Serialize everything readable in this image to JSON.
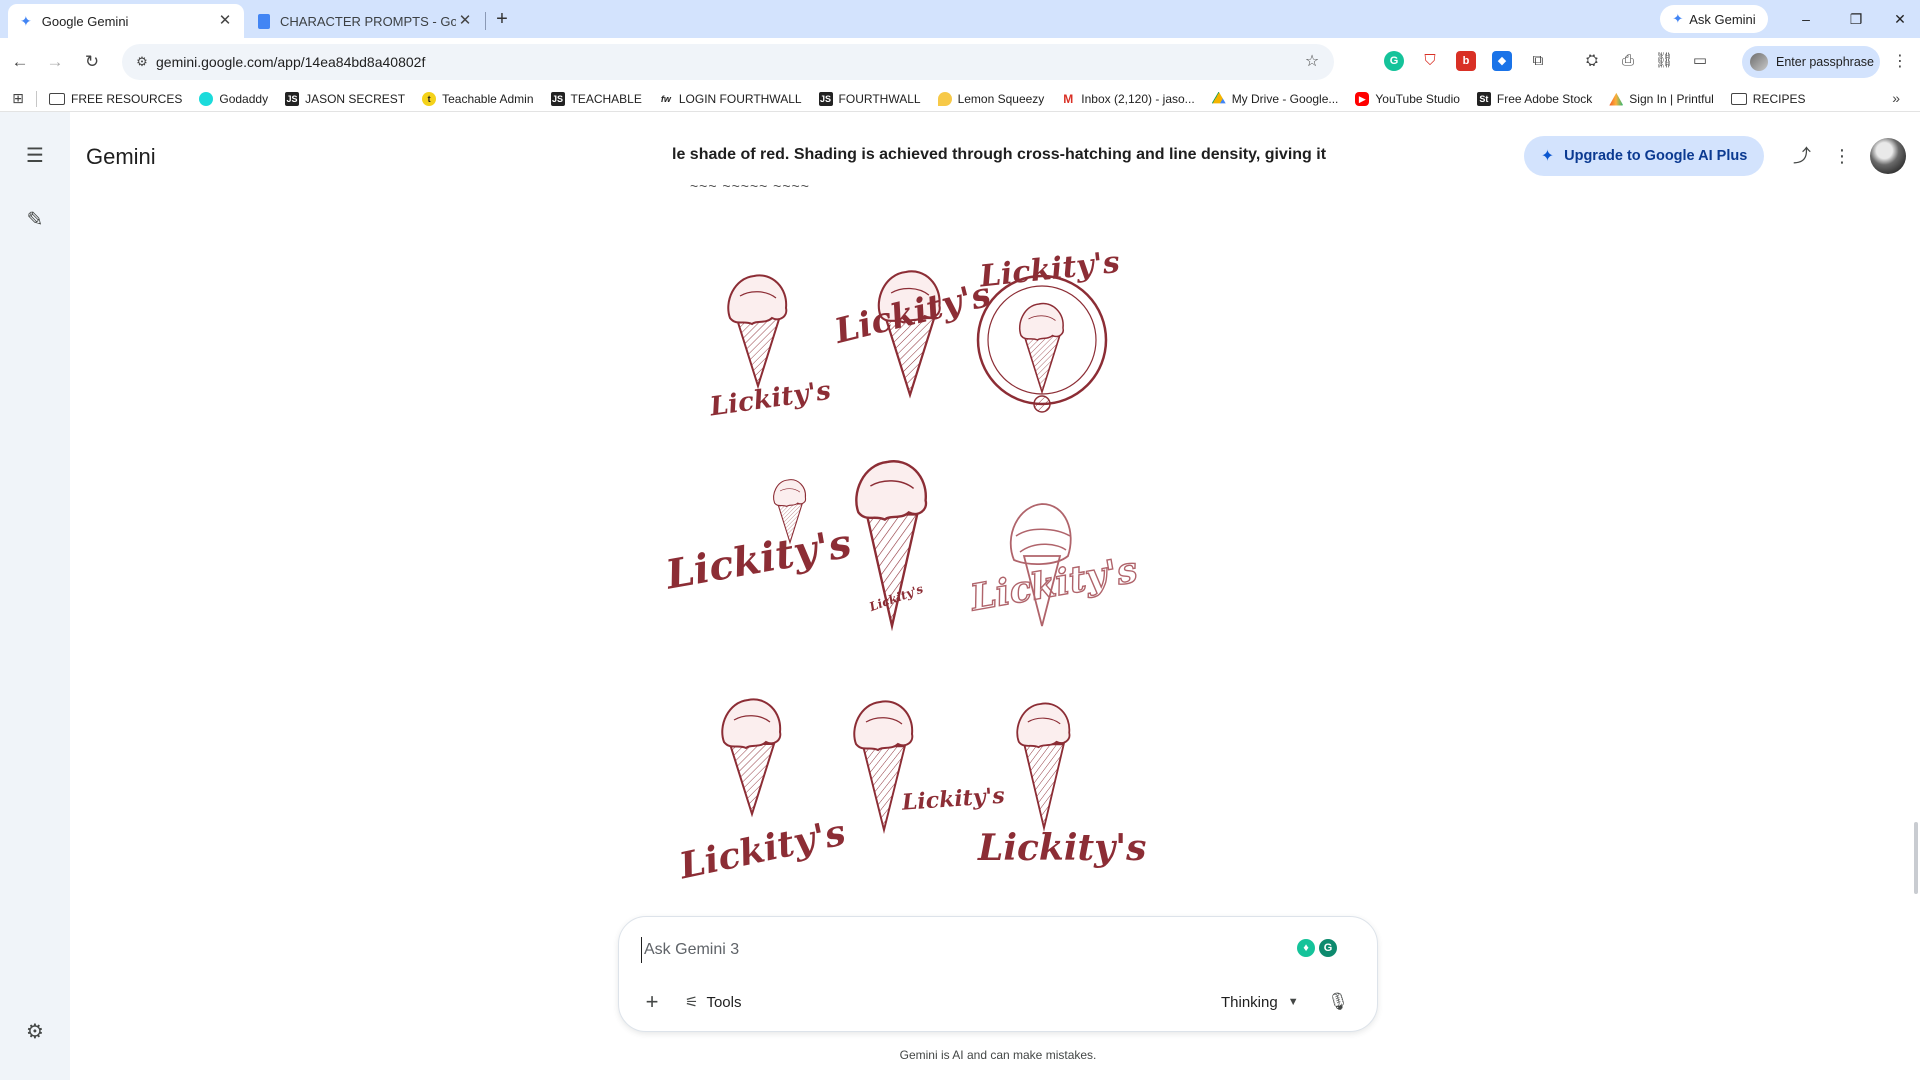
{
  "browser": {
    "tabs": [
      {
        "title": "Google Gemini",
        "icon": "gemini-sparkle-icon"
      },
      {
        "title": "CHARACTER PROMPTS - Googl",
        "icon": "google-docs-icon"
      }
    ],
    "ask_gemini": "Ask Gemini",
    "url": "gemini.google.com/app/14ea84bd8a40802f",
    "profile_label": "Enter passphrase",
    "window_controls": {
      "minimize": "–",
      "restore": "❐",
      "close": "✕"
    }
  },
  "bookmarks": [
    {
      "label": "FREE RESOURCES",
      "icon": "folder-icon"
    },
    {
      "label": "Godaddy",
      "icon": "godaddy-icon"
    },
    {
      "label": "JASON SECREST",
      "icon": "js-icon"
    },
    {
      "label": "Teachable Admin",
      "icon": "teachable-icon"
    },
    {
      "label": "TEACHABLE",
      "icon": "js-icon"
    },
    {
      "label": "LOGIN FOURTHWALL",
      "icon": "fw-icon"
    },
    {
      "label": "FOURTHWALL",
      "icon": "js-icon"
    },
    {
      "label": "Lemon Squeezy",
      "icon": "lemon-icon"
    },
    {
      "label": "Inbox (2,120) - jaso...",
      "icon": "gmail-icon"
    },
    {
      "label": "My Drive - Google...",
      "icon": "drive-icon"
    },
    {
      "label": "YouTube Studio",
      "icon": "youtube-icon"
    },
    {
      "label": "Free Adobe Stock",
      "icon": "adobe-stock-icon"
    },
    {
      "label": "Sign In | Printful",
      "icon": "printful-icon"
    },
    {
      "label": "RECIPES",
      "icon": "folder-icon"
    }
  ],
  "app": {
    "name": "Gemini",
    "conversation_title": "le shade of red. Shading is achieved through cross-hatching and line density, giving it",
    "upgrade_label": "Upgrade to Google AI Plus",
    "logo_word": "Lickity's",
    "badge_letters": "Lickity's"
  },
  "prompt": {
    "placeholder": "Ask Gemini 3",
    "tools_label": "Tools",
    "mode_label": "Thinking",
    "disclaimer": "Gemini is AI and can make mistakes."
  },
  "colors": {
    "tab_strip": "#d3e3fd",
    "sketch_red": "#8c2d35",
    "upgrade_bg": "#d3e3fd",
    "sidebar_bg": "#f0f4f9"
  }
}
